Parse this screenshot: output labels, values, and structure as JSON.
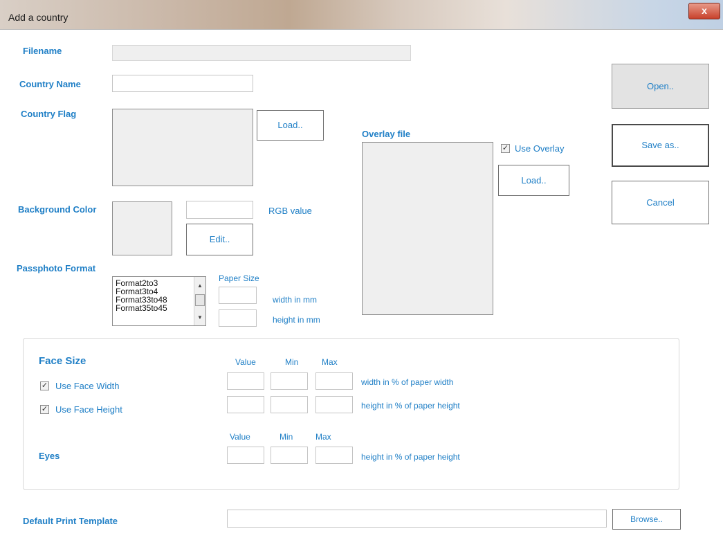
{
  "window": {
    "title": "Add a country",
    "close_label": "x"
  },
  "filename": {
    "label": "Filename",
    "value": ""
  },
  "country_name": {
    "label": "Country Name",
    "value": ""
  },
  "country_flag": {
    "label": "Country Flag",
    "load_label": "Load.."
  },
  "overlay": {
    "label": "Overlay file",
    "use_overlay_label": "Use Overlay",
    "use_overlay_checked": true,
    "load_label": "Load.."
  },
  "background_color": {
    "label": "Background Color",
    "rgb_value": "",
    "rgb_label": "RGB value",
    "edit_label": "Edit.."
  },
  "passphoto": {
    "label": "Passphoto Format",
    "formats": [
      "Format2to3",
      "Format3to4",
      "Format33to48",
      "Format35to45"
    ],
    "paper_size_label": "Paper Size",
    "width_label": "width in mm",
    "height_label": "height in mm"
  },
  "actions": {
    "open_label": "Open..",
    "save_label": "Save as..",
    "cancel_label": "Cancel"
  },
  "face_size": {
    "title": "Face Size",
    "col_value": "Value",
    "col_min": "Min",
    "col_max": "Max",
    "use_width_label": "Use Face Width",
    "use_width_checked": true,
    "use_height_label": "Use Face Height",
    "use_height_checked": true,
    "width_desc": "width in % of paper width",
    "height_desc": "height in % of paper height"
  },
  "eyes": {
    "label": "Eyes",
    "col_value": "Value",
    "col_min": "Min",
    "col_max": "Max",
    "desc": "height in % of paper height"
  },
  "print_template": {
    "label": "Default Print Template",
    "value": "",
    "browse_label": "Browse.."
  }
}
